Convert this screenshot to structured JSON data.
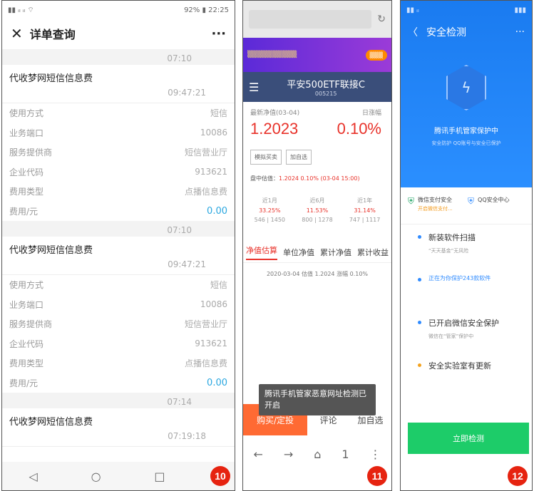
{
  "phone1": {
    "status_time": "22:25",
    "status_battery": "92%",
    "title": "详单查询",
    "more": "···",
    "records": [
      {
        "time": "07:10",
        "title": "代收梦网短信信息费",
        "subtime": "09:47:21",
        "fields": [
          {
            "k": "使用方式",
            "v": "短信"
          },
          {
            "k": "业务端口",
            "v": "10086"
          },
          {
            "k": "服务提供商",
            "v": "短信营业厅"
          },
          {
            "k": "企业代码",
            "v": "913621"
          },
          {
            "k": "费用类型",
            "v": "点播信息费"
          },
          {
            "k": "费用/元",
            "v": "0.00"
          }
        ]
      },
      {
        "time": "07:10",
        "title": "代收梦网短信信息费",
        "subtime": "09:47:21",
        "fields": [
          {
            "k": "使用方式",
            "v": "短信"
          },
          {
            "k": "业务端口",
            "v": "10086"
          },
          {
            "k": "服务提供商",
            "v": "短信营业厅"
          },
          {
            "k": "企业代码",
            "v": "913621"
          },
          {
            "k": "费用类型",
            "v": "点播信息费"
          },
          {
            "k": "费用/元",
            "v": "0.00"
          }
        ]
      },
      {
        "time": "07:14",
        "title": "代收梦网短信信息费",
        "subtime": "07:19:18",
        "fields": []
      }
    ],
    "badge": "10"
  },
  "phone2": {
    "fund_name": "平安500ETF联接C",
    "fund_code": "005215",
    "nav_label": "最新净值(03-04)",
    "nav_value": "1.2023",
    "change_label": "日涨幅",
    "change_value": "0.10%",
    "btn1": "模拟买卖",
    "btn2": "加自选",
    "estimate_label": "盘中估值：",
    "estimate_value": "1.2024 0.10% (03-04 15:00)",
    "perf": [
      {
        "label": "近1月",
        "value": "33.25%",
        "rank": "546 | 1450"
      },
      {
        "label": "近6月",
        "value": "11.53%",
        "rank": "800 | 1278"
      },
      {
        "label": "近1年",
        "value": "31.14%",
        "rank": "747 | 1117"
      }
    ],
    "tabs": [
      "净值估算",
      "单位净值",
      "累计净值",
      "累计收益"
    ],
    "nav_line": "2020-03-04 估值 1.2024 涨幅 0.10%",
    "toast": "腾讯手机管家恶意网址检测已开启",
    "actions": [
      "购买/定投",
      "评论",
      "加自选"
    ],
    "browser": [
      "←",
      "→",
      "⌂",
      "1",
      "⋮"
    ],
    "badge": "11"
  },
  "phone3": {
    "title": "安全检测",
    "hero_title": "腾讯手机管家保护中",
    "hero_sub": "安全防护  QQ账号与安全已保护",
    "card1_title": "微信支付安全",
    "card1_sub": "开启微信支付...",
    "card2_title": "QQ安全中心",
    "items": [
      {
        "title": "新装软件扫描",
        "sub": "“天天基金”无风险",
        "style": "normal"
      },
      {
        "title": "正在为你保护243款软件",
        "sub": "",
        "style": "blue"
      },
      {
        "title": "已开启微信安全保护",
        "sub": "微信在“管家”保护中",
        "style": "normal"
      },
      {
        "title": "安全实验室有更新",
        "sub": "",
        "style": "orange"
      }
    ],
    "button": "立即检测",
    "badge": "12"
  }
}
